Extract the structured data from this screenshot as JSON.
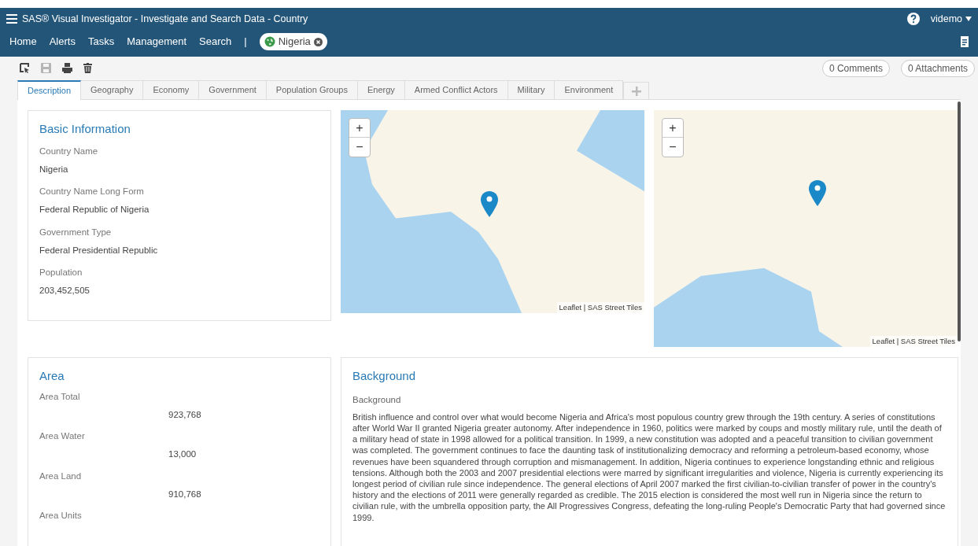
{
  "window": {
    "title": "SAS® Visual Investigator - Investigate and Search Data - Country",
    "user": "videmo"
  },
  "nav": {
    "items": [
      "Home",
      "Alerts",
      "Tasks",
      "Management",
      "Search"
    ],
    "separator": "|",
    "open_object": {
      "label": "Nigeria"
    }
  },
  "toolbar": {
    "save_disabled": true,
    "comments": "0 Comments",
    "attachments": "0 Attachments"
  },
  "tabs": [
    {
      "label": "Description",
      "selected": true
    },
    {
      "label": "Geography",
      "selected": false
    },
    {
      "label": "Economy",
      "selected": false
    },
    {
      "label": "Government",
      "selected": false
    },
    {
      "label": "Population Groups",
      "selected": false
    },
    {
      "label": "Energy",
      "selected": false
    },
    {
      "label": "Armed Conflict Actors",
      "selected": false
    },
    {
      "label": "Military",
      "selected": false
    },
    {
      "label": "Environment",
      "selected": false
    }
  ],
  "basic_information": {
    "title": "Basic Information",
    "fields": [
      {
        "label": "Country Name",
        "value": "Nigeria"
      },
      {
        "label": "Country Name Long Form",
        "value": "Federal Republic of Nigeria"
      },
      {
        "label": "Government Type",
        "value": "Federal Presidential Republic"
      },
      {
        "label": "Population",
        "value": "203,452,505"
      }
    ]
  },
  "maps": [
    {
      "zoom_in": "+",
      "zoom_out": "−",
      "attribution": "Leaflet | SAS Street Tiles"
    },
    {
      "zoom_in": "+",
      "zoom_out": "−",
      "attribution": "Leaflet | SAS Street Tiles"
    }
  ],
  "area": {
    "title": "Area",
    "fields": [
      {
        "label": "Area Total",
        "value": "923,768"
      },
      {
        "label": "Area Water",
        "value": "13,000"
      },
      {
        "label": "Area Land",
        "value": "910,768"
      },
      {
        "label": "Area Units"
      }
    ]
  },
  "background": {
    "title": "Background",
    "label": "Background",
    "text": "British influence and control over what would become Nigeria and Africa's most populous country grew through the 19th century. A series of constitutions after World War II granted Nigeria greater autonomy. After independence in 1960, politics were marked by coups and mostly military rule, until the death of a military head of state in 1998 allowed for a political transition. In 1999, a new constitution was adopted and a peaceful transition to civilian government was completed. The government continues to face the daunting task of institutionalizing democracy and reforming a petroleum-based economy, whose revenues have been squandered through corruption and mismanagement. In addition, Nigeria continues to experience longstanding ethnic and religious tensions. Although both the 2003 and 2007 presidential elections were marred by significant irregularities and violence, Nigeria is currently experiencing its longest period of civilian rule since independence. The general elections of April 2007 marked the first civilian-to-civilian transfer of power in the country's history and the elections of 2011 were generally regarded as credible. The 2015 election is considered the most well run in Nigeria since the return to civilian rule, with the umbrella opposition party, the All Progressives Congress, defeating the long-ruling People's Democratic Party that had governed since 1999."
  }
}
